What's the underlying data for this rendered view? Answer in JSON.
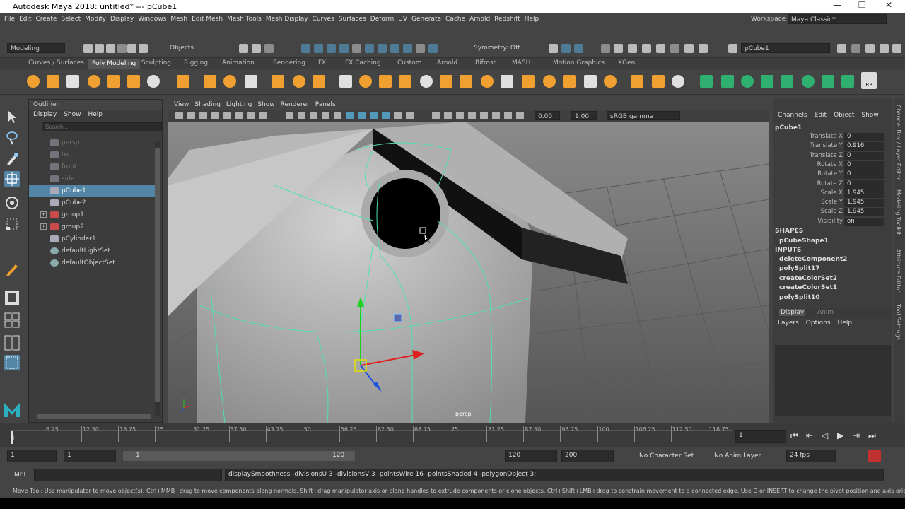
{
  "window": {
    "title": "Autodesk Maya 2018: untitled*   ---   pCube1",
    "minimize": "—",
    "maximize": "❐",
    "close": "✕"
  },
  "menu": [
    "File",
    "Edit",
    "Create",
    "Select",
    "Modify",
    "Display",
    "Windows",
    "Mesh",
    "Edit Mesh",
    "Mesh Tools",
    "Mesh Display",
    "Curves",
    "Surfaces",
    "Deform",
    "UV",
    "Generate",
    "Cache",
    "Arnold",
    "Redshift",
    "Help"
  ],
  "workspace": {
    "label": "Workspace :",
    "value": "Maya Classic*"
  },
  "toolbar": {
    "mode": "Modeling",
    "objects": "Objects",
    "symmetry": "Symmetry: Off",
    "object_field": "pCube1"
  },
  "shelf_tabs": [
    "Curves / Surfaces",
    "Poly Modeling",
    "Sculpting",
    "Rigging",
    "Animation",
    "Rendering",
    "FX",
    "FX Caching",
    "Custom",
    "Arnold",
    "Bifrost",
    "MASH",
    "Motion Graphics",
    "XGen"
  ],
  "shelf_active": "Poly Modeling",
  "shelf_badge": "RP",
  "outliner": {
    "title": "Outliner",
    "menu": [
      "Display",
      "Show",
      "Help"
    ],
    "search_placeholder": "Search...",
    "items": [
      {
        "label": "persp",
        "dim": true,
        "icon": "camera-icon"
      },
      {
        "label": "top",
        "dim": true,
        "icon": "camera-icon"
      },
      {
        "label": "front",
        "dim": true,
        "icon": "camera-icon"
      },
      {
        "label": "side",
        "dim": true,
        "icon": "camera-icon"
      },
      {
        "label": "pCube1",
        "selected": true,
        "icon": "mesh-icon"
      },
      {
        "label": "pCube2",
        "icon": "mesh-icon"
      },
      {
        "label": "group1",
        "icon": "group-icon",
        "expand": "+"
      },
      {
        "label": "group2",
        "icon": "group-icon",
        "expand": "+"
      },
      {
        "label": "pCylinder1",
        "icon": "mesh-icon"
      },
      {
        "label": "defaultLightSet",
        "icon": "set-icon"
      },
      {
        "label": "defaultObjectSet",
        "icon": "set-icon"
      }
    ]
  },
  "viewport": {
    "menu": [
      "View",
      "Shading",
      "Lighting",
      "Show",
      "Renderer",
      "Panels"
    ],
    "exposure": "0.00",
    "gamma": "1.00",
    "colorspace": "sRGB gamma",
    "camera_label": "persp"
  },
  "channel_box": {
    "menu": [
      "Channels",
      "Edit",
      "Object",
      "Show"
    ],
    "object": "pCube1",
    "attrs": [
      {
        "label": "Translate X",
        "value": "0"
      },
      {
        "label": "Translate Y",
        "value": "0.916"
      },
      {
        "label": "Translate Z",
        "value": "0"
      },
      {
        "label": "Rotate X",
        "value": "0"
      },
      {
        "label": "Rotate Y",
        "value": "0"
      },
      {
        "label": "Rotate Z",
        "value": "0"
      },
      {
        "label": "Scale X",
        "value": "1.945"
      },
      {
        "label": "Scale Y",
        "value": "1.945"
      },
      {
        "label": "Scale Z",
        "value": "1.945"
      },
      {
        "label": "Visibility",
        "value": "on"
      }
    ],
    "shapes_header": "SHAPES",
    "shape": "pCubeShape1",
    "inputs_header": "INPUTS",
    "inputs": [
      "deleteComponent2",
      "polySplit17",
      "createColorSet2",
      "createColorSet1",
      "polySplit10"
    ],
    "layer_tabs": [
      "Display",
      "Anim"
    ],
    "layer_menu": [
      "Layers",
      "Options",
      "Help"
    ]
  },
  "right_tabs": [
    "Channel Box / Layer Editor",
    "Modeling Toolkit",
    "Attribute Editor",
    "Tool Settings"
  ],
  "timeline": {
    "ticks": [
      "6.25",
      "12.50",
      "18.75",
      "25",
      "31.25",
      "37.50",
      "43.75",
      "50",
      "56.25",
      "62.50",
      "68.75",
      "75",
      "81.25",
      "87.50",
      "93.75",
      "100",
      "106.25",
      "112.50",
      "118.75"
    ],
    "first": "1",
    "current": "1"
  },
  "range": {
    "start": "1",
    "start2": "1",
    "slider_start": "1",
    "slider_end": "120",
    "end": "120",
    "end2": "200",
    "char_set": "No Character Set",
    "anim_layer": "No Anim Layer",
    "fps": "24 fps"
  },
  "command": {
    "lang": "MEL",
    "output": "displaySmoothness -divisionsU 3 -divisionsV 3 -pointsWire 16 -pointsShaded 4 -polygonObject 3;"
  },
  "help_line": "Move Tool: Use manipulator to move object(s). Ctrl+MMB+drag to move components along normals. Shift+drag manipulator axis or plane handles to extrude components or clone objects. Ctrl+Shift+LMB+drag to constrain movement to a connected edge. Use D or INSERT to change the pivot position and axis orientation.",
  "colors": {
    "accent": "#5285a6",
    "shelf_orange": "#f0a030",
    "wire_green": "#50e0b0",
    "x_axis": "#e02020",
    "y_axis": "#20d020",
    "z_axis": "#2050e0"
  }
}
